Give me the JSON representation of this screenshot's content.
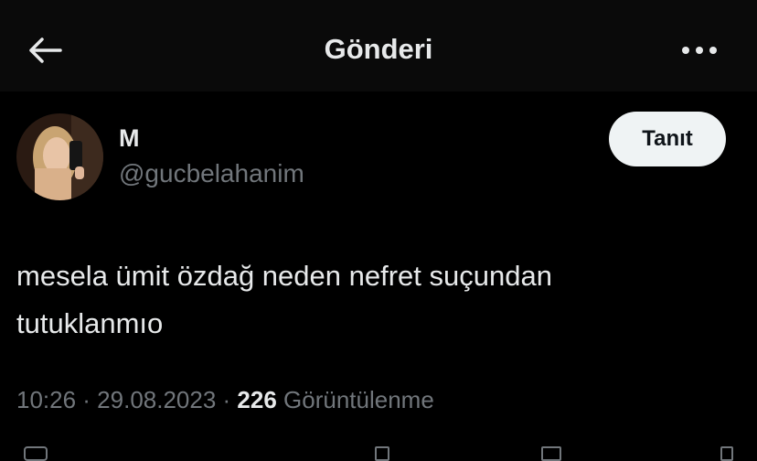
{
  "header": {
    "title": "Gönderi",
    "back_icon": "arrow-left-icon",
    "more_icon": "more-horizontal-icon"
  },
  "author": {
    "display_name": "M",
    "handle": "@gucbelahanim",
    "avatar_icon": "profile-photo"
  },
  "follow_button": {
    "label": "Tanıt"
  },
  "tweet": {
    "text": "mesela ümit özdağ neden nefret suçundan\ntutuklanmıo"
  },
  "meta": {
    "time_date": "10:26 · 29.08.2023 · ",
    "views_count": "226",
    "views_label": "Görüntülenme"
  },
  "colors": {
    "background": "#000000",
    "text": "#e7e9ea",
    "secondary": "#71767b",
    "button_bg": "#eff3f4"
  }
}
